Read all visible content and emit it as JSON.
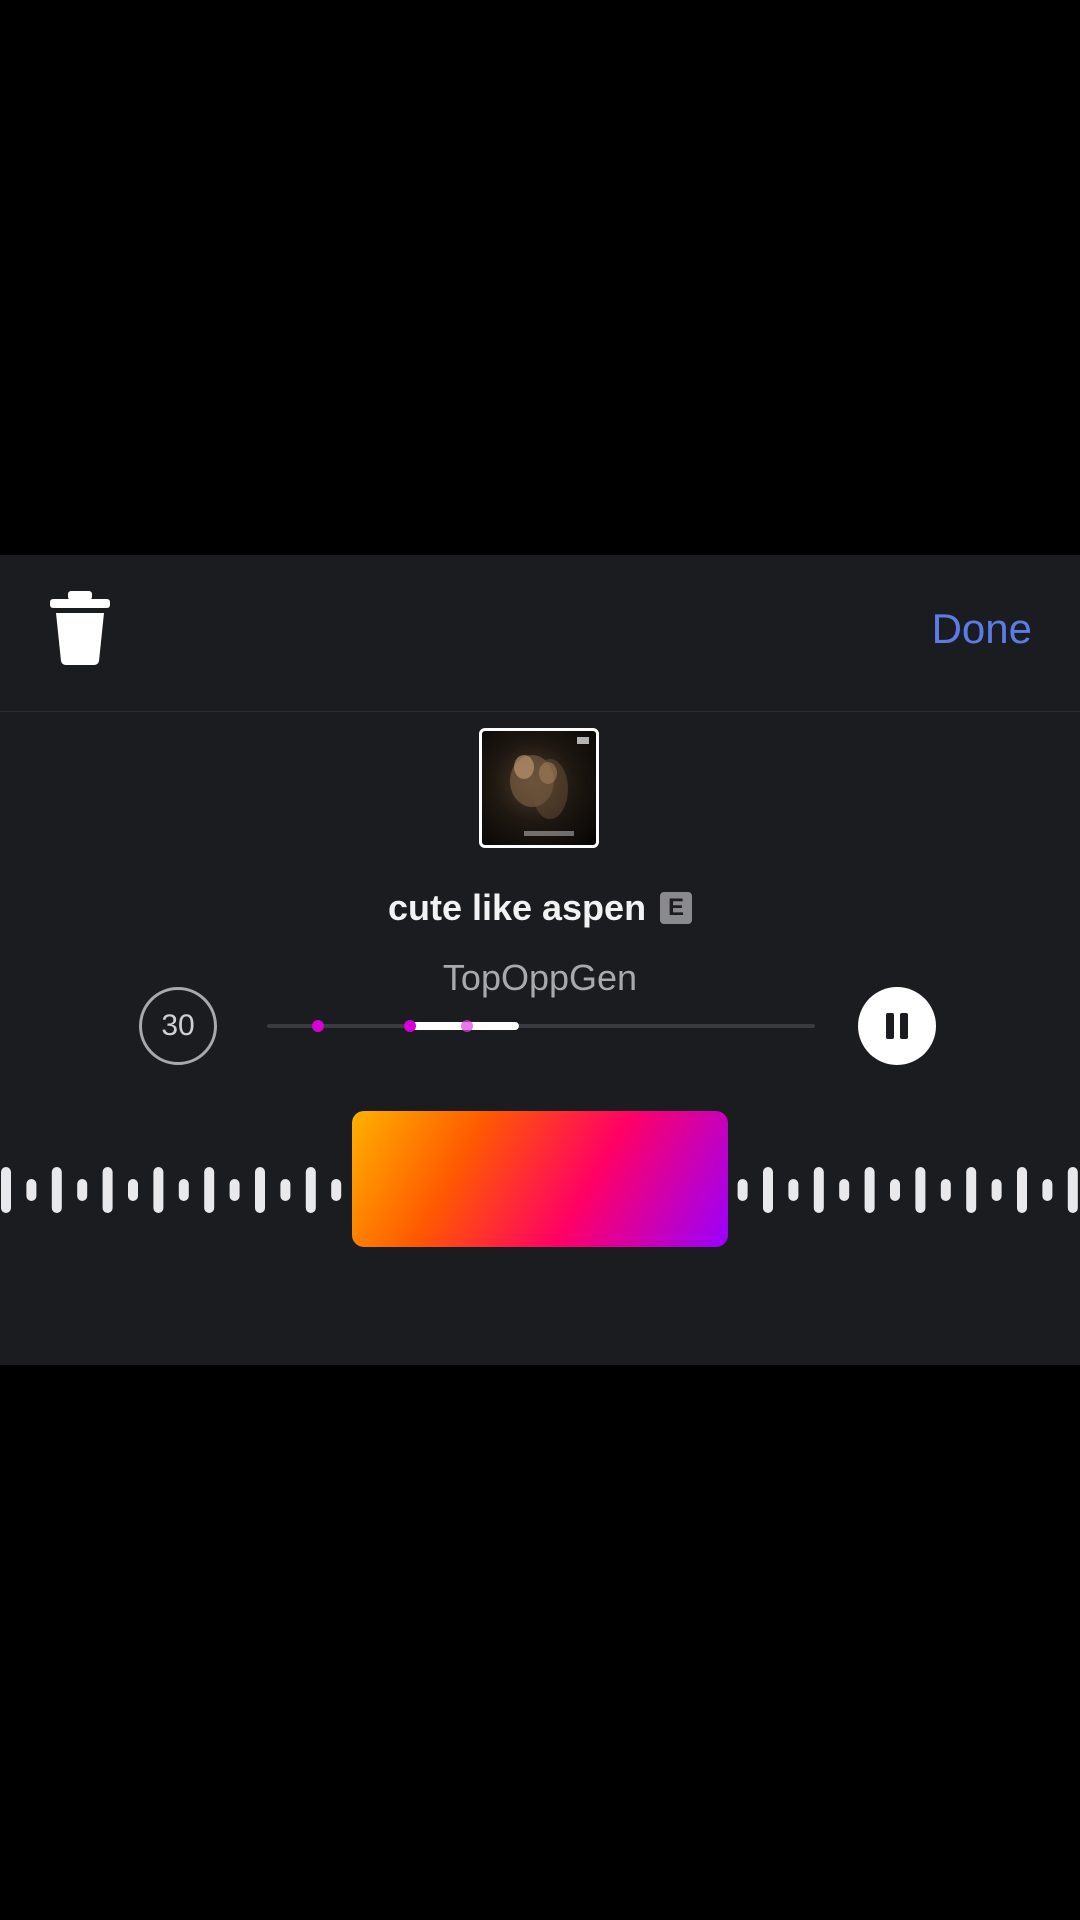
{
  "toolbar": {
    "delete_icon": "trash-icon",
    "done_label": "Done",
    "done_color": "#5b7ce8"
  },
  "track": {
    "title": "cute like aspen",
    "explicit_badge": "E",
    "artist": "TopOppGen",
    "album_art_label": "album-cover"
  },
  "player": {
    "clip_duration": "30",
    "playback_state": "playing",
    "pause_icon": "pause-icon",
    "progress_selected_start_fraction": 0.26,
    "progress_selected_end_fraction": 0.46,
    "marker_color": "#d600d6"
  },
  "waveform": {
    "selector_gradient": [
      "#ffb100",
      "#ff5a00",
      "#ff0066",
      "#9900ff"
    ]
  }
}
